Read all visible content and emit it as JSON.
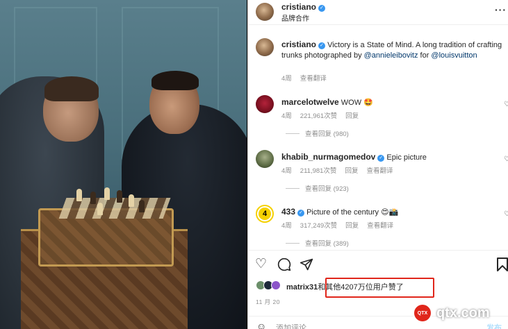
{
  "post": {
    "author": "cristiano",
    "subtitle": "品牌合作"
  },
  "caption": {
    "author": "cristiano",
    "text_plain": " Victory is a State of Mind. A long tradition of crafting trunks photographed by ",
    "mention1": "@annieleibovitz",
    "text_mid": " for ",
    "mention2": "@louisvuitton",
    "time": "4周",
    "translate": "查看翻译"
  },
  "comments": [
    {
      "user": "marcelotwelve",
      "text": "WOW 🤩",
      "time": "4周",
      "likes": "221,961次赞",
      "reply": "回复",
      "translate": "",
      "replies": "查看回复 (980)"
    },
    {
      "user": "khabib_nurmagomedov",
      "text": "Epic picture",
      "time": "4周",
      "likes": "211,981次赞",
      "reply": "回复",
      "translate": "查看翻译",
      "replies": "查看回复 (923)"
    },
    {
      "user": "433",
      "text": "Picture of the century 😍📸",
      "time": "4周",
      "likes": "317,249次赞",
      "reply": "回复",
      "translate": "查看翻译",
      "replies": "查看回复 (389)"
    }
  ],
  "likes": {
    "user": "matrix31",
    "rest": "和其他4207万位用户赞了"
  },
  "date": "11 月 20",
  "add_comment": {
    "placeholder": "添加评论……",
    "post": "发布"
  },
  "watermark": {
    "text": "qtx.com"
  }
}
